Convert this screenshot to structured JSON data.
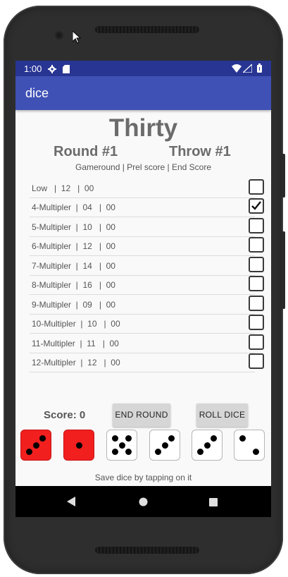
{
  "status": {
    "time": "1:00"
  },
  "app": {
    "title": "dice"
  },
  "game": {
    "title": "Thirty",
    "round": "Round #1",
    "throw": "Throw #1",
    "subheader": "Gameround  |  Prel score | End Score"
  },
  "rows": [
    {
      "label": "Low   |  12   |  00",
      "checked": false
    },
    {
      "label": "4-Multipler  |  04   |  00",
      "checked": true
    },
    {
      "label": "5-Multipler  |  10   |  00",
      "checked": false
    },
    {
      "label": "6-Multipler  |  12   |  00",
      "checked": false
    },
    {
      "label": "7-Multipler  |  14   |  00",
      "checked": false
    },
    {
      "label": "8-Multipler  |  16   |  00",
      "checked": false
    },
    {
      "label": "9-Multipler  |  09   |  00",
      "checked": false
    },
    {
      "label": "10-Multipler  |  10   |  00",
      "checked": false
    },
    {
      "label": "11-Multipler  |  11   |  00",
      "checked": false
    },
    {
      "label": "12-Multipler  |  12   |  00",
      "checked": false
    }
  ],
  "controls": {
    "score": "Score: 0",
    "end_round": "END ROUND",
    "roll_dice": "ROLL DICE",
    "hint": "Save dice by tapping on it"
  },
  "dice": [
    {
      "value": 3,
      "saved": true
    },
    {
      "value": 1,
      "saved": true
    },
    {
      "value": 5,
      "saved": false
    },
    {
      "value": 3,
      "saved": false
    },
    {
      "value": 3,
      "saved": false
    },
    {
      "value": 2,
      "saved": false
    }
  ],
  "colors": {
    "appbar": "#3f51b5",
    "statusbar": "#283593",
    "saved_die": "#f21f1f"
  }
}
